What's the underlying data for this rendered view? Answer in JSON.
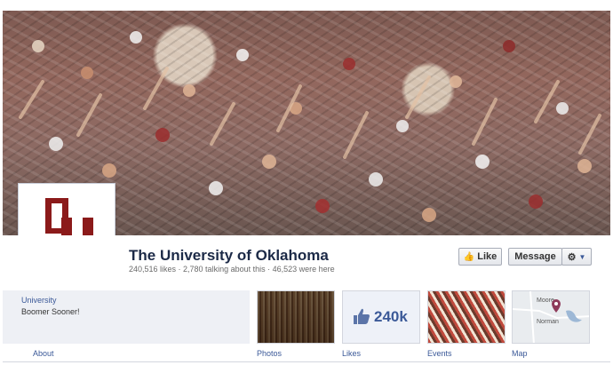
{
  "cover": {
    "image": "crowd-cover-photo"
  },
  "profile": {
    "logo": "ou-logo",
    "logo_color": "#8b1a1a"
  },
  "page": {
    "title": "The University of Oklahoma",
    "stats": "240,516 likes · 2,780 talking about this · 46,523 were here"
  },
  "actions": {
    "like_label": "Like",
    "message_label": "Message"
  },
  "about": {
    "category": "University",
    "description": "Boomer Sooner!"
  },
  "apps": {
    "about_label": "About",
    "photos_label": "Photos",
    "likes_label": "Likes",
    "likes_count": "240k",
    "events_label": "Events",
    "map_label": "Map"
  },
  "map": {
    "place1": "Moore",
    "place2": "Norman"
  },
  "colors": {
    "link": "#3b5998",
    "title": "#1c2a47",
    "crimson": "#8b1a1a"
  }
}
